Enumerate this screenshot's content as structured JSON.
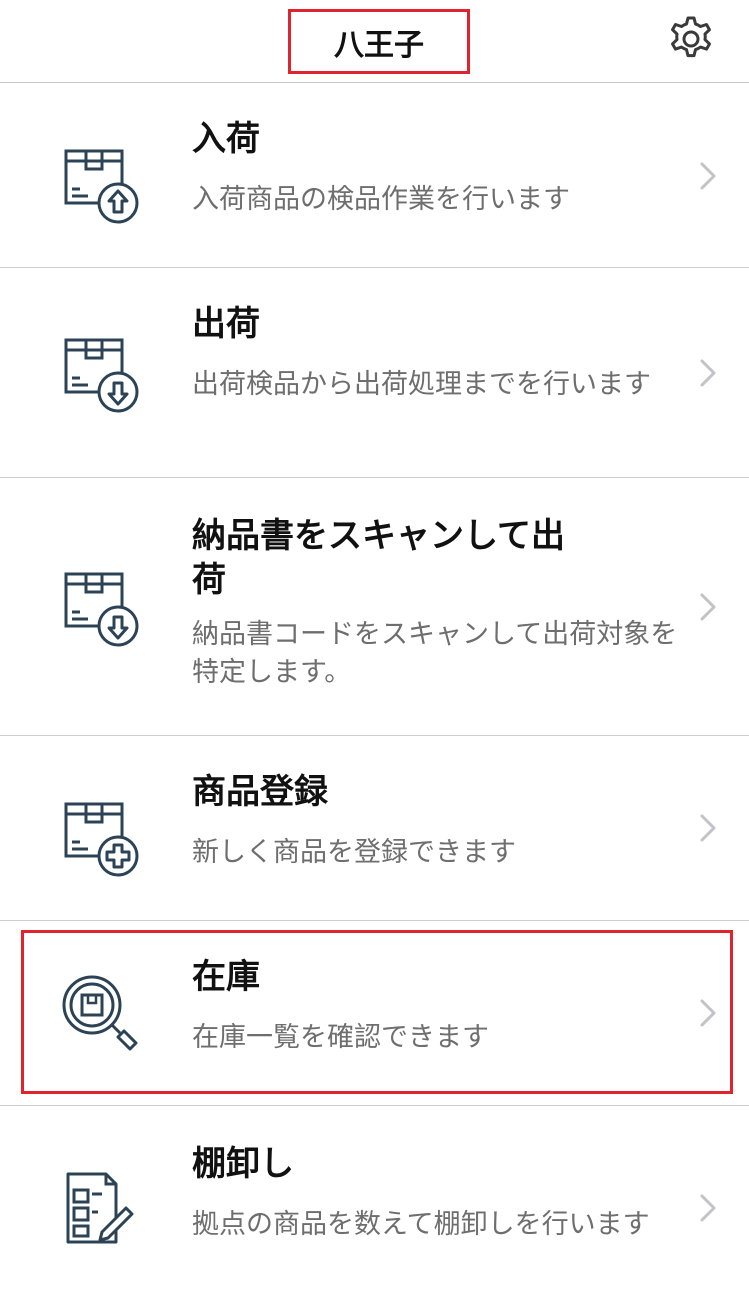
{
  "header": {
    "title": "八王子",
    "settings_icon": "gear-icon"
  },
  "menu": [
    {
      "title": "入荷",
      "description": "入荷商品の検品作業を行います",
      "icon": "box-arrow-up-icon"
    },
    {
      "title": "出荷",
      "description": "出荷検品から出荷処理までを行います",
      "icon": "box-arrow-down-icon"
    },
    {
      "title": "納品書をスキャンして出荷",
      "description": "納品書コードをスキャンして出荷対象を特定します。",
      "icon": "box-arrow-down-icon"
    },
    {
      "title": "商品登録",
      "description": "新しく商品を登録できます",
      "icon": "box-plus-icon"
    },
    {
      "title": "在庫",
      "description": "在庫一覧を確認できます",
      "icon": "magnifier-box-icon"
    },
    {
      "title": "棚卸し",
      "description": "拠点の商品を数えて棚卸しを行います",
      "icon": "clipboard-pen-icon"
    }
  ],
  "colors": {
    "icon": "#2c4356",
    "highlight": "#e0242f",
    "description": "#6e6e6e",
    "chevron": "#c2c2c7"
  }
}
